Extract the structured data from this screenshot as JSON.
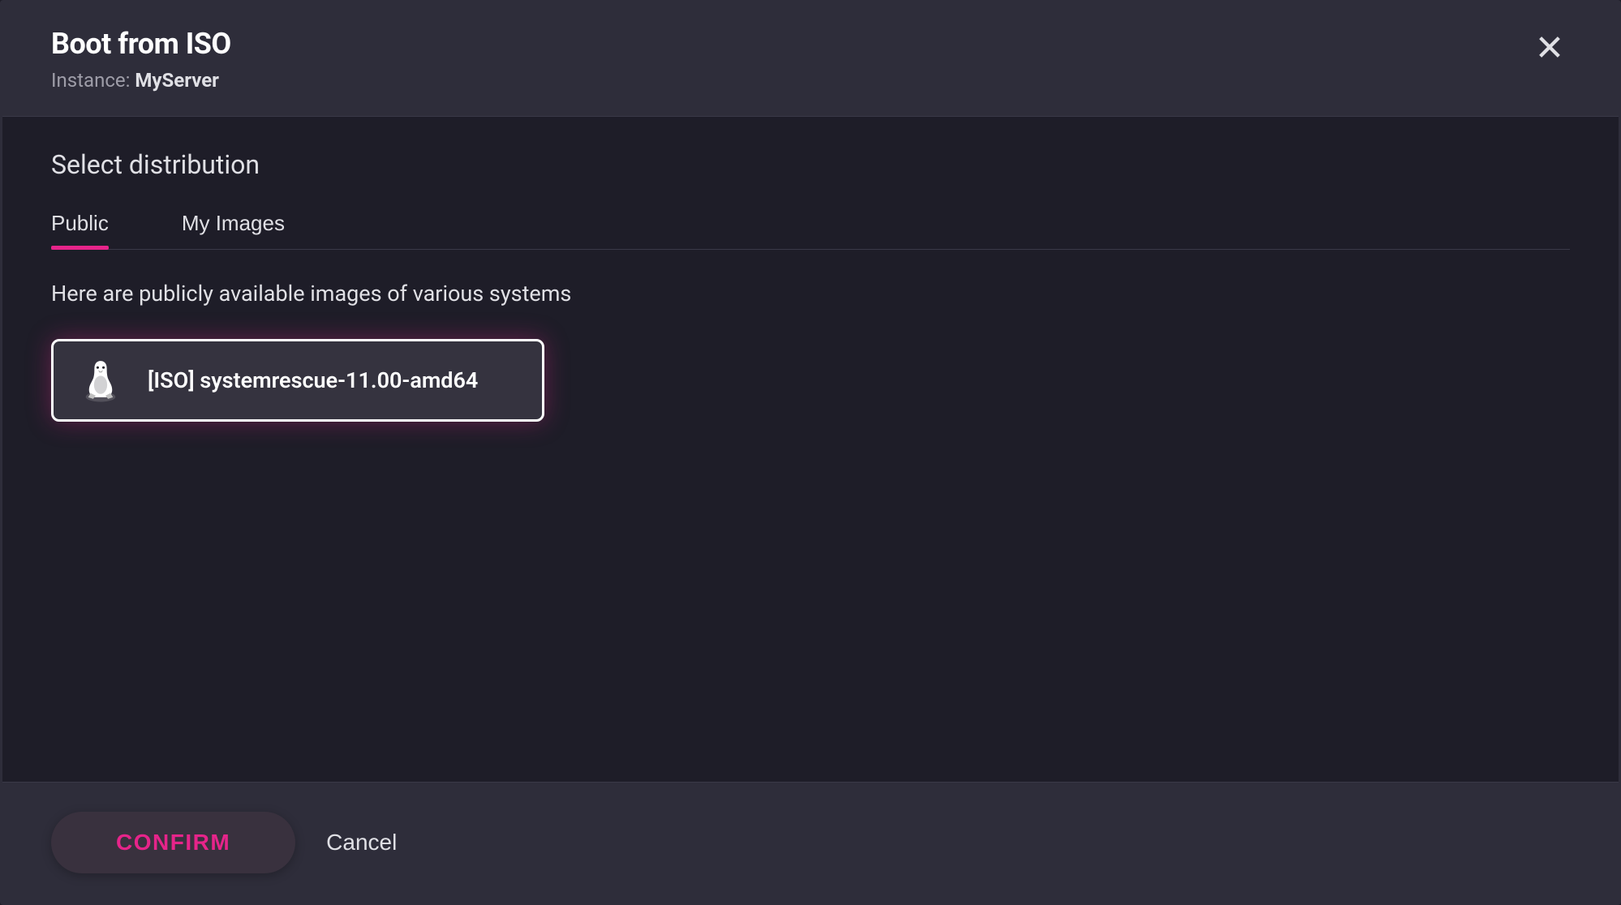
{
  "header": {
    "title": "Boot from ISO",
    "instance_label": "Instance: ",
    "instance_name": "MyServer"
  },
  "body": {
    "section_title": "Select distribution",
    "tabs": [
      {
        "label": "Public",
        "active": true
      },
      {
        "label": "My Images",
        "active": false
      }
    ],
    "tab_description": "Here are publicly available images of various systems",
    "images": [
      {
        "icon": "linux-tux-icon",
        "label": "[ISO] systemrescue-11.00-amd64",
        "selected": true
      }
    ]
  },
  "footer": {
    "confirm_label": "CONFIRM",
    "cancel_label": "Cancel"
  }
}
